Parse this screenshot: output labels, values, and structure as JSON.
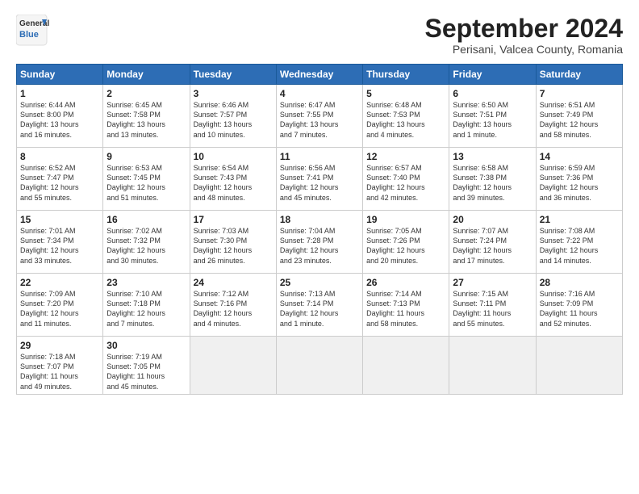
{
  "logo": {
    "line1": "General",
    "line2": "Blue"
  },
  "title": "September 2024",
  "subtitle": "Perisani, Valcea County, Romania",
  "weekdays": [
    "Sunday",
    "Monday",
    "Tuesday",
    "Wednesday",
    "Thursday",
    "Friday",
    "Saturday"
  ],
  "weeks": [
    [
      {
        "day": "1",
        "info": "Sunrise: 6:44 AM\nSunset: 8:00 PM\nDaylight: 13 hours\nand 16 minutes."
      },
      {
        "day": "2",
        "info": "Sunrise: 6:45 AM\nSunset: 7:58 PM\nDaylight: 13 hours\nand 13 minutes."
      },
      {
        "day": "3",
        "info": "Sunrise: 6:46 AM\nSunset: 7:57 PM\nDaylight: 13 hours\nand 10 minutes."
      },
      {
        "day": "4",
        "info": "Sunrise: 6:47 AM\nSunset: 7:55 PM\nDaylight: 13 hours\nand 7 minutes."
      },
      {
        "day": "5",
        "info": "Sunrise: 6:48 AM\nSunset: 7:53 PM\nDaylight: 13 hours\nand 4 minutes."
      },
      {
        "day": "6",
        "info": "Sunrise: 6:50 AM\nSunset: 7:51 PM\nDaylight: 13 hours\nand 1 minute."
      },
      {
        "day": "7",
        "info": "Sunrise: 6:51 AM\nSunset: 7:49 PM\nDaylight: 12 hours\nand 58 minutes."
      }
    ],
    [
      {
        "day": "8",
        "info": "Sunrise: 6:52 AM\nSunset: 7:47 PM\nDaylight: 12 hours\nand 55 minutes."
      },
      {
        "day": "9",
        "info": "Sunrise: 6:53 AM\nSunset: 7:45 PM\nDaylight: 12 hours\nand 51 minutes."
      },
      {
        "day": "10",
        "info": "Sunrise: 6:54 AM\nSunset: 7:43 PM\nDaylight: 12 hours\nand 48 minutes."
      },
      {
        "day": "11",
        "info": "Sunrise: 6:56 AM\nSunset: 7:41 PM\nDaylight: 12 hours\nand 45 minutes."
      },
      {
        "day": "12",
        "info": "Sunrise: 6:57 AM\nSunset: 7:40 PM\nDaylight: 12 hours\nand 42 minutes."
      },
      {
        "day": "13",
        "info": "Sunrise: 6:58 AM\nSunset: 7:38 PM\nDaylight: 12 hours\nand 39 minutes."
      },
      {
        "day": "14",
        "info": "Sunrise: 6:59 AM\nSunset: 7:36 PM\nDaylight: 12 hours\nand 36 minutes."
      }
    ],
    [
      {
        "day": "15",
        "info": "Sunrise: 7:01 AM\nSunset: 7:34 PM\nDaylight: 12 hours\nand 33 minutes."
      },
      {
        "day": "16",
        "info": "Sunrise: 7:02 AM\nSunset: 7:32 PM\nDaylight: 12 hours\nand 30 minutes."
      },
      {
        "day": "17",
        "info": "Sunrise: 7:03 AM\nSunset: 7:30 PM\nDaylight: 12 hours\nand 26 minutes."
      },
      {
        "day": "18",
        "info": "Sunrise: 7:04 AM\nSunset: 7:28 PM\nDaylight: 12 hours\nand 23 minutes."
      },
      {
        "day": "19",
        "info": "Sunrise: 7:05 AM\nSunset: 7:26 PM\nDaylight: 12 hours\nand 20 minutes."
      },
      {
        "day": "20",
        "info": "Sunrise: 7:07 AM\nSunset: 7:24 PM\nDaylight: 12 hours\nand 17 minutes."
      },
      {
        "day": "21",
        "info": "Sunrise: 7:08 AM\nSunset: 7:22 PM\nDaylight: 12 hours\nand 14 minutes."
      }
    ],
    [
      {
        "day": "22",
        "info": "Sunrise: 7:09 AM\nSunset: 7:20 PM\nDaylight: 12 hours\nand 11 minutes."
      },
      {
        "day": "23",
        "info": "Sunrise: 7:10 AM\nSunset: 7:18 PM\nDaylight: 12 hours\nand 7 minutes."
      },
      {
        "day": "24",
        "info": "Sunrise: 7:12 AM\nSunset: 7:16 PM\nDaylight: 12 hours\nand 4 minutes."
      },
      {
        "day": "25",
        "info": "Sunrise: 7:13 AM\nSunset: 7:14 PM\nDaylight: 12 hours\nand 1 minute."
      },
      {
        "day": "26",
        "info": "Sunrise: 7:14 AM\nSunset: 7:13 PM\nDaylight: 11 hours\nand 58 minutes."
      },
      {
        "day": "27",
        "info": "Sunrise: 7:15 AM\nSunset: 7:11 PM\nDaylight: 11 hours\nand 55 minutes."
      },
      {
        "day": "28",
        "info": "Sunrise: 7:16 AM\nSunset: 7:09 PM\nDaylight: 11 hours\nand 52 minutes."
      }
    ],
    [
      {
        "day": "29",
        "info": "Sunrise: 7:18 AM\nSunset: 7:07 PM\nDaylight: 11 hours\nand 49 minutes."
      },
      {
        "day": "30",
        "info": "Sunrise: 7:19 AM\nSunset: 7:05 PM\nDaylight: 11 hours\nand 45 minutes."
      },
      {
        "day": "",
        "info": ""
      },
      {
        "day": "",
        "info": ""
      },
      {
        "day": "",
        "info": ""
      },
      {
        "day": "",
        "info": ""
      },
      {
        "day": "",
        "info": ""
      }
    ]
  ]
}
